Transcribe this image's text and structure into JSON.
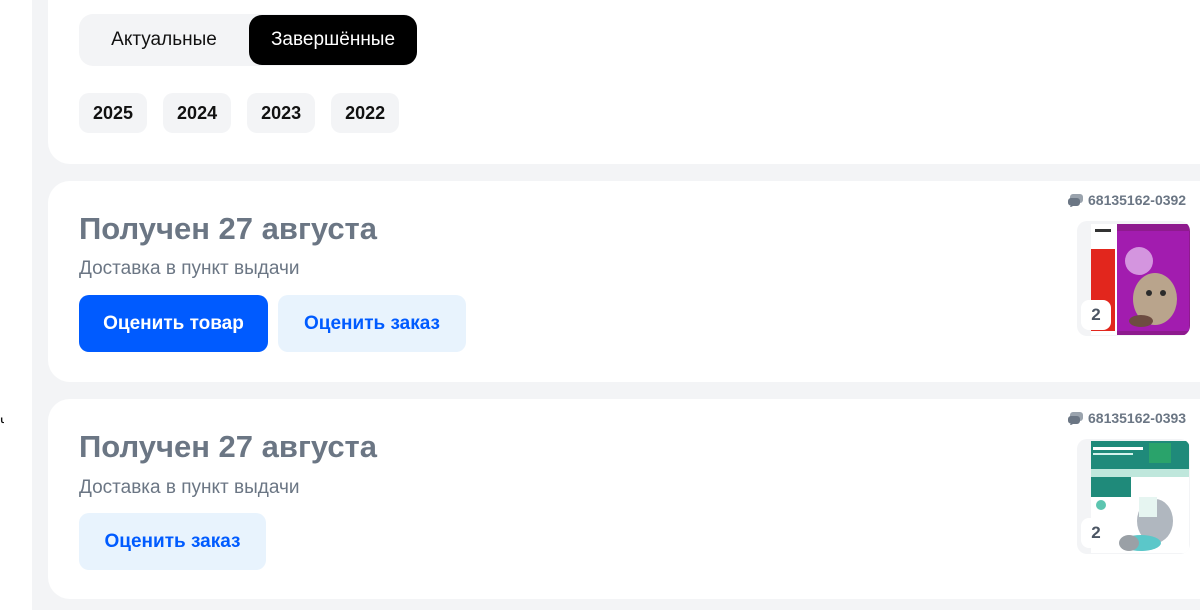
{
  "tabs": {
    "current": "Актуальные",
    "completed": "Завершённые"
  },
  "years": [
    "2025",
    "2024",
    "2023",
    "2022"
  ],
  "edge_fragment": "ч",
  "orders": [
    {
      "title": "Получен 27 августа",
      "delivery": "Доставка в пункт выдачи",
      "rate_item_label": "Оценить товар",
      "rate_order_label": "Оценить заказ",
      "number": "68135162-0392",
      "quantity": "2",
      "product_icon": "cat-food-pouch"
    },
    {
      "title": "Получен 27 августа",
      "delivery": "Доставка в пункт выдачи",
      "rate_order_label": "Оценить заказ",
      "number": "68135162-0393",
      "quantity": "2",
      "product_icon": "cat-litter-bag"
    }
  ],
  "colors": {
    "primary": "#005bff",
    "secondary_bg": "#e8f3fd",
    "muted_text": "#6b7684",
    "active_tab": "#000000"
  }
}
